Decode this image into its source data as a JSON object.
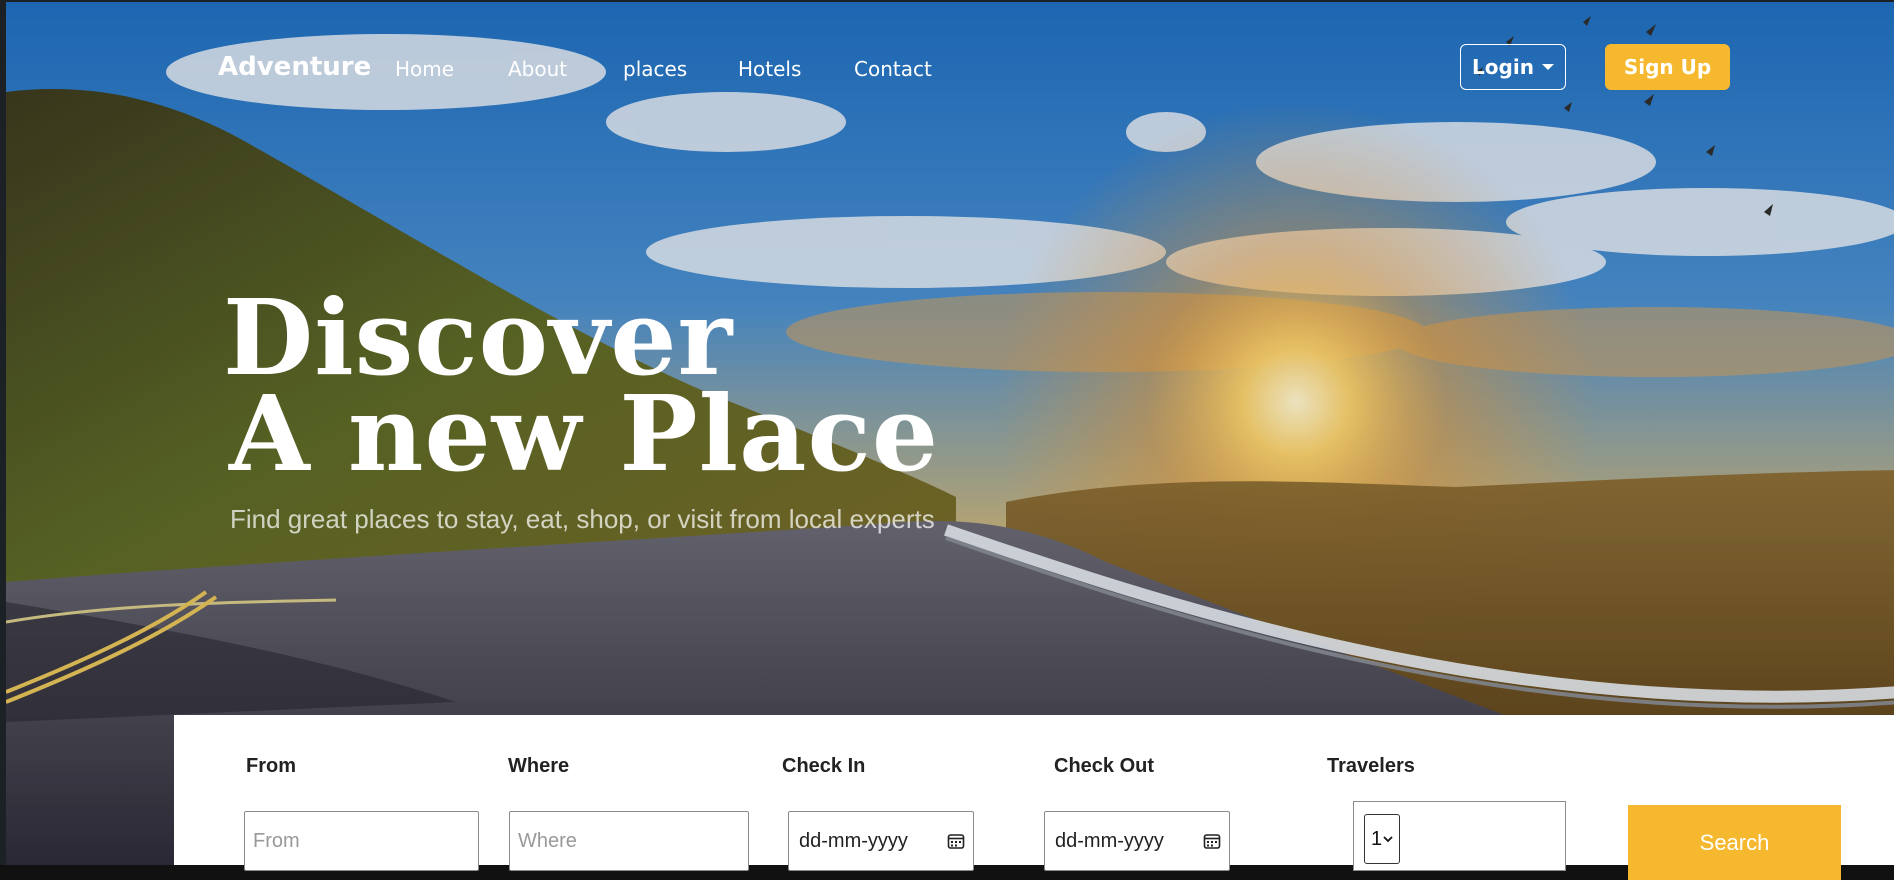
{
  "brand": "Adventure",
  "nav": {
    "links": [
      "Home",
      "About",
      "places",
      "Hotels",
      "Contact"
    ],
    "login_label": "Login",
    "signup_label": "Sign Up"
  },
  "hero": {
    "title_line1": "Discover",
    "title_line2": "A new Place",
    "subtitle": "Find great places to stay, eat, shop, or visit from local experts"
  },
  "search": {
    "from_label": "From",
    "from_placeholder": "From",
    "where_label": "Where",
    "where_placeholder": "Where",
    "checkin_label": "Check In",
    "checkin_value": "dd-mm-yyyy",
    "checkout_label": "Check Out",
    "checkout_value": "dd-mm-yyyy",
    "travelers_label": "Travelers",
    "travelers_value": "1",
    "button_label": "Search"
  },
  "colors": {
    "accent": "#f5b82f",
    "panel_bg": "#ffffff"
  },
  "icons": [
    "calendar-icon",
    "caret-down-icon",
    "chevron-down-icon"
  ]
}
